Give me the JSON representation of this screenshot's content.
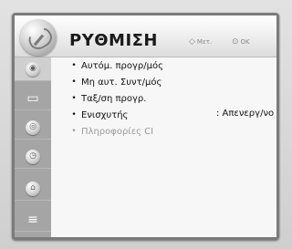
{
  "header": {
    "title": "ΡΥΘΜΙΣΗ",
    "move_glyph": "◇",
    "move_label": "Μετ.",
    "ok_glyph": "⊙",
    "ok_label": "OK"
  },
  "sidebar": {
    "items": [
      {
        "icon": "satellite-icon",
        "glyph": "◉",
        "active": true
      },
      {
        "icon": "display-icon",
        "glyph": "▭"
      },
      {
        "icon": "audio-icon",
        "glyph": "◎"
      },
      {
        "icon": "clock-icon",
        "glyph": "◷"
      },
      {
        "icon": "lock-icon",
        "glyph": "⌂"
      },
      {
        "icon": "options-icon",
        "glyph": "≡"
      }
    ]
  },
  "menu": {
    "items": [
      {
        "bullet": "•",
        "label": "Αυτόμ. προγρ/μός",
        "value": ""
      },
      {
        "bullet": "•",
        "label": "Μη αυτ. Συντ/μός",
        "value": ""
      },
      {
        "bullet": "•",
        "label": "Ταξ/ση προγρ.",
        "value": ""
      },
      {
        "bullet": "•",
        "label": "Ενισχυτής",
        "value": ": Απενεργ/νο"
      },
      {
        "bullet": "•",
        "label": "Πληροφορίες CI",
        "value": "",
        "disabled": true
      }
    ]
  }
}
